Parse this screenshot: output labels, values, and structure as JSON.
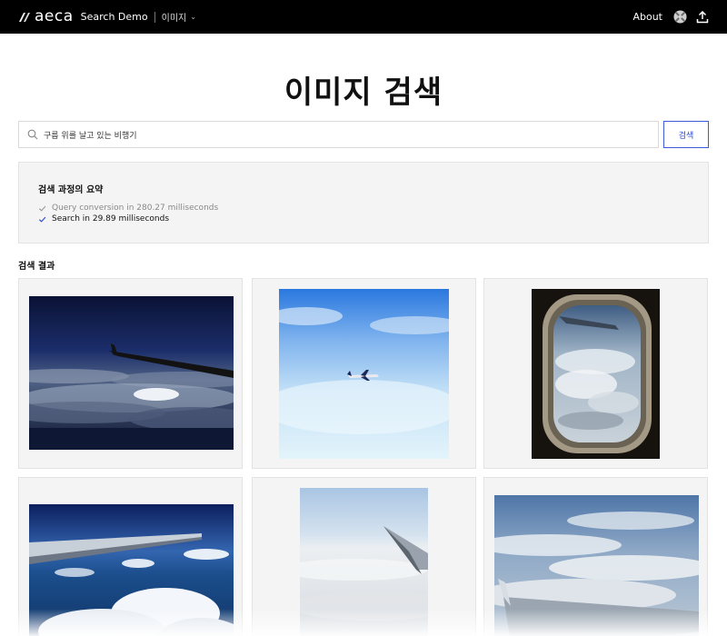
{
  "header": {
    "brand": "aeca",
    "product": "Search Demo",
    "mode": "이미지",
    "about": "About",
    "icons": [
      "aeca-logo-icon",
      "chevron-down-icon",
      "globe-icon",
      "upload-icon"
    ]
  },
  "page": {
    "title": "이미지 검색"
  },
  "search": {
    "value": "구름 위를 날고 있는 비행기",
    "button": "검색"
  },
  "summary": {
    "title": "검색 과정의 요약",
    "steps": [
      "Query conversion in 280.27 milliseconds",
      "Search in 29.89 milliseconds"
    ]
  },
  "results": {
    "label": "검색 결과",
    "images": [
      "wing-over-dark-clouds",
      "airplane-in-blue-sky",
      "airplane-window-view",
      "wing-over-ocean-clouds",
      "wing-above-cloud-layer",
      "wing-over-cloudscape"
    ]
  },
  "colors": {
    "topbar": "#000000",
    "accent": "#2a4bd1",
    "panel": "#f4f4f4"
  }
}
